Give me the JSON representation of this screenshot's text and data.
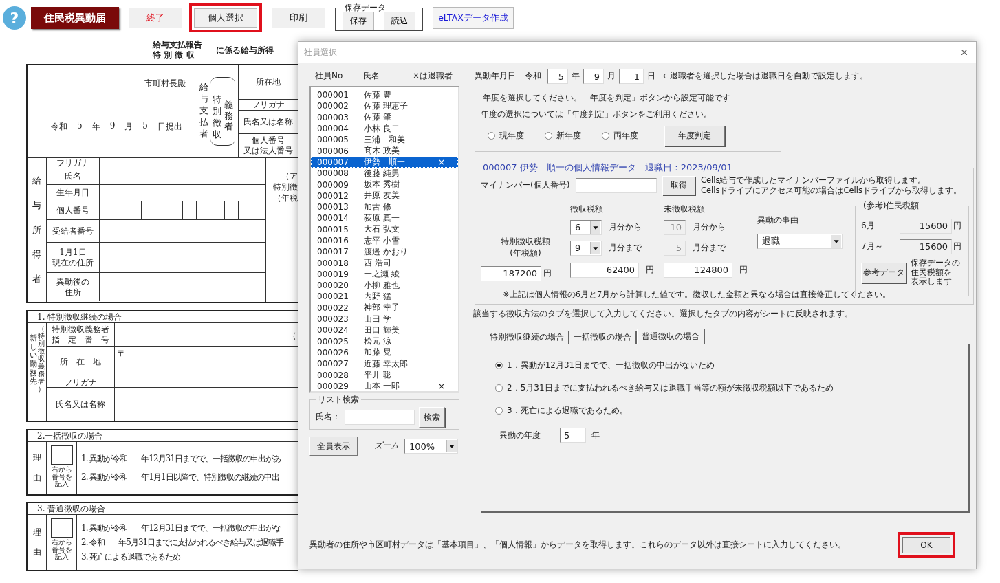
{
  "toolbar": {
    "help": "?",
    "title": "住民税異動届",
    "buttons": [
      {
        "label": "終了",
        "kind": "danger",
        "highlighted": false
      },
      {
        "label": "個人選択",
        "kind": "normal",
        "highlighted": true
      },
      {
        "label": "印刷",
        "kind": "normal",
        "highlighted": false
      }
    ],
    "saved_data": {
      "legend": "保存データ",
      "buttons": [
        "保存",
        "読込"
      ]
    },
    "eltax": {
      "label": "eLTAXデータ作成"
    }
  },
  "sheet": {
    "heading": {
      "line_1": "給与支払報告",
      "line_2": "特 別 徴 収",
      "suffix": "に係る給与所得"
    },
    "payer": {
      "addressee": "市町村長殿",
      "submitted": [
        "令和",
        "5",
        "年",
        "9",
        "月",
        "5",
        "日提出"
      ],
      "side_label": "給与支払者",
      "duty_label_1": "特別徴収",
      "duty_label_2": "義務者",
      "fields": [
        [
          "所在地"
        ],
        [
          "フリガナ"
        ],
        [
          "氏名又は名称"
        ],
        [
          "個人番号",
          "又は法人番号"
        ]
      ]
    },
    "employee": {
      "side_label": "給与所得者",
      "rows": [
        {
          "label": [
            "フリガナ"
          ],
          "kind": "text"
        },
        {
          "label": [
            "氏名"
          ],
          "kind": "text"
        },
        {
          "label": [
            "生年月日"
          ],
          "kind": "text"
        },
        {
          "label": [
            "個人番号"
          ],
          "kind": "digits"
        },
        {
          "label": [
            "受給者番号"
          ],
          "kind": "text"
        },
        {
          "label": [
            "1月1日",
            "現在の住所"
          ],
          "kind": "text"
        },
        {
          "label": [
            "異動後の",
            "住所"
          ],
          "kind": "text"
        }
      ],
      "right_texts": [
        "（ア",
        "特別徴",
        "（年税"
      ]
    },
    "section_1": {
      "title": "1. 特別徴収継続の場合",
      "side_label_1": "新しい勤務先",
      "side_label_2": "（特別徴収義務者）",
      "rows": [
        {
          "label": [
            "特別徴収義務者",
            "指　定　番　号"
          ],
          "trailing": "（"
        },
        {
          "label": [
            "所　在　地"
          ],
          "value": "〒"
        },
        {
          "label": [
            "フリガナ"
          ]
        },
        {
          "label": [
            "氏名又は名称"
          ]
        }
      ]
    },
    "section_2": {
      "title": "2.一括徴収の場合",
      "reason_label": "理由",
      "box_note": [
        "右から",
        "番号を",
        "記入"
      ],
      "lines": [
        {
          "lead": "1. 異動が令和",
          "rest": "年12月31日までで、一括徴収の申出があ"
        },
        {
          "lead": "2. 異動が令和",
          "rest": "年1月1日以降で、特別徴収の継続の申出"
        }
      ]
    },
    "section_3": {
      "title": "3. 普通徴収の場合",
      "reason_label": "理由",
      "box_note": [
        "右から",
        "番号を",
        "記入"
      ],
      "lines": [
        {
          "lead": "1. 異動が令和",
          "rest": "年12月31日までで、一括徴収の申出がな"
        },
        {
          "lead": "2. 令和",
          "rest": "年5月31日までに支払われるべき給与又は退職手"
        },
        {
          "lead": "3. 死亡による退職であるため"
        }
      ]
    }
  },
  "dialog": {
    "title": "社員選択",
    "list_header": [
      "社員No",
      "氏名",
      "×は退職者"
    ],
    "employees": [
      {
        "no": "000001",
        "name": "佐藤 豊",
        "selected": false
      },
      {
        "no": "000002",
        "name": "佐藤 理恵子",
        "selected": false
      },
      {
        "no": "000003",
        "name": "佐藤 肇",
        "selected": false
      },
      {
        "no": "000004",
        "name": "小林 良二",
        "selected": false
      },
      {
        "no": "000005",
        "name": "三浦　和美",
        "selected": false
      },
      {
        "no": "000006",
        "name": "髙木 政美",
        "selected": false
      },
      {
        "no": "000007",
        "name": "伊勢　順一",
        "selected": true,
        "retired_mark": "×"
      },
      {
        "no": "000008",
        "name": "後藤 純男",
        "selected": false
      },
      {
        "no": "000009",
        "name": "坂本 秀樹",
        "selected": false
      },
      {
        "no": "000012",
        "name": "井原 友美",
        "selected": false
      },
      {
        "no": "000013",
        "name": "加古 修",
        "selected": false
      },
      {
        "no": "000014",
        "name": "荻原 真一",
        "selected": false
      },
      {
        "no": "000015",
        "name": "大石 弘文",
        "selected": false
      },
      {
        "no": "000016",
        "name": "志平 小雪",
        "selected": false
      },
      {
        "no": "000017",
        "name": "渡邉 かおり",
        "selected": false
      },
      {
        "no": "000018",
        "name": "西 浩司",
        "selected": false
      },
      {
        "no": "000019",
        "name": "一之瀬 綾",
        "selected": false
      },
      {
        "no": "000020",
        "name": "小柳 雅也",
        "selected": false
      },
      {
        "no": "000021",
        "name": "内野 猛",
        "selected": false
      },
      {
        "no": "000022",
        "name": "神部 幸子",
        "selected": false
      },
      {
        "no": "000023",
        "name": "山田 学",
        "selected": false
      },
      {
        "no": "000024",
        "name": "田口 輝美",
        "selected": false
      },
      {
        "no": "000025",
        "name": "松元 涼",
        "selected": false
      },
      {
        "no": "000026",
        "name": "加藤 晃",
        "selected": false
      },
      {
        "no": "000027",
        "name": "近藤 幸太郎",
        "selected": false
      },
      {
        "no": "000028",
        "name": "平井 聡",
        "selected": false
      },
      {
        "no": "000029",
        "name": "山本 一郎",
        "selected": false,
        "retired_mark": "×"
      }
    ],
    "search": {
      "legend": "リスト検索",
      "label": "氏名：",
      "button": "検索"
    },
    "show_all": "全員表示",
    "zoom": {
      "label": "ズーム",
      "value": "100%"
    },
    "date": {
      "label": "異動年月日",
      "era": "令和",
      "year": "5",
      "year_unit": "年",
      "month": "9",
      "month_unit": "月",
      "day": "1",
      "day_unit": "日",
      "note": "←退職者を選択した場合は退職日を自動で設定します。"
    },
    "fiscal": {
      "legend": "年度を選択してください。「年度を判定」ボタンから設定可能です",
      "note": "年度の選択については「年度判定」ボタンをご利用ください。",
      "options": [
        {
          "label": "現年度",
          "selected": false
        },
        {
          "label": "新年度",
          "selected": false
        },
        {
          "label": "両年度",
          "selected": false
        }
      ],
      "button": "年度判定"
    },
    "personal": {
      "legend": "000007 伊勢　順一の個人情報データ　退職日：2023/09/01",
      "mynumber_label": "マイナンバー(個人番号)",
      "fetch_button": "取得",
      "fetch_note": [
        "Cells給与で作成したマイナンバーファイルから取得します。",
        "Cellsドライブにアクセス可能の場合はCellsドライブから取得します。"
      ],
      "annual_label": [
        "特別徴収税額",
        "(年税額)"
      ],
      "annual": {
        "value": "187200",
        "unit": "円"
      },
      "columns": [
        {
          "label": "徴収税額",
          "rows": [
            {
              "value": "6",
              "unit": "月分から",
              "kind": "select"
            },
            {
              "value": "9",
              "unit": "月分まで",
              "kind": "select"
            },
            {
              "value": "62400",
              "unit": "円",
              "kind": "amount"
            }
          ]
        },
        {
          "label": "未徴収税額",
          "rows": [
            {
              "value": "10",
              "unit": "月分から",
              "kind": "disabled"
            },
            {
              "value": "5",
              "unit": "月分まで",
              "kind": "disabled"
            },
            {
              "value": "124800",
              "unit": "円",
              "kind": "amount"
            }
          ]
        }
      ],
      "reason_label": "異動の事由",
      "reason": "退職",
      "reference": {
        "legend": "(参考)住民税額",
        "rows": [
          {
            "label": "6月",
            "value": "15600",
            "unit": "円"
          },
          {
            "label": "7月～",
            "value": "15600",
            "unit": "円"
          }
        ],
        "button": "参考データ",
        "note": [
          "保存データの",
          "住民税額を",
          "表示します"
        ]
      },
      "note": "※上記は個人情報の6月と7月から計算した値です。徴収した金額と異なる場合は直接修正してください。"
    },
    "tab_note": "該当する徴収方法のタブを選択して入力してください。選択したタブの内容がシートに反映されます。",
    "tabs": [
      {
        "label": "特別徴収継続の場合",
        "selected": false
      },
      {
        "label": "一括徴収の場合",
        "selected": false
      },
      {
        "label": "普通徴収の場合",
        "selected": true
      }
    ],
    "reasons": [
      {
        "label": "1．異動が12月31日までで、一括徴収の申出がないため",
        "selected": true
      },
      {
        "label": "2．5月31日までに支払われるべき給与又は退職手当等の額が未徴収税額以下であるため",
        "selected": false
      },
      {
        "label": "3．死亡による退職であるため。",
        "selected": false
      }
    ],
    "change_year": {
      "label": "異動の年度",
      "value": "5",
      "unit": "年"
    },
    "footer_note": "異動者の住所や市区町村データは「基本項目」、「個人情報」からデータを取得します。これらのデータ以外は直接シートに入力してください。",
    "ok": {
      "label": "OK",
      "highlighted": true
    }
  }
}
